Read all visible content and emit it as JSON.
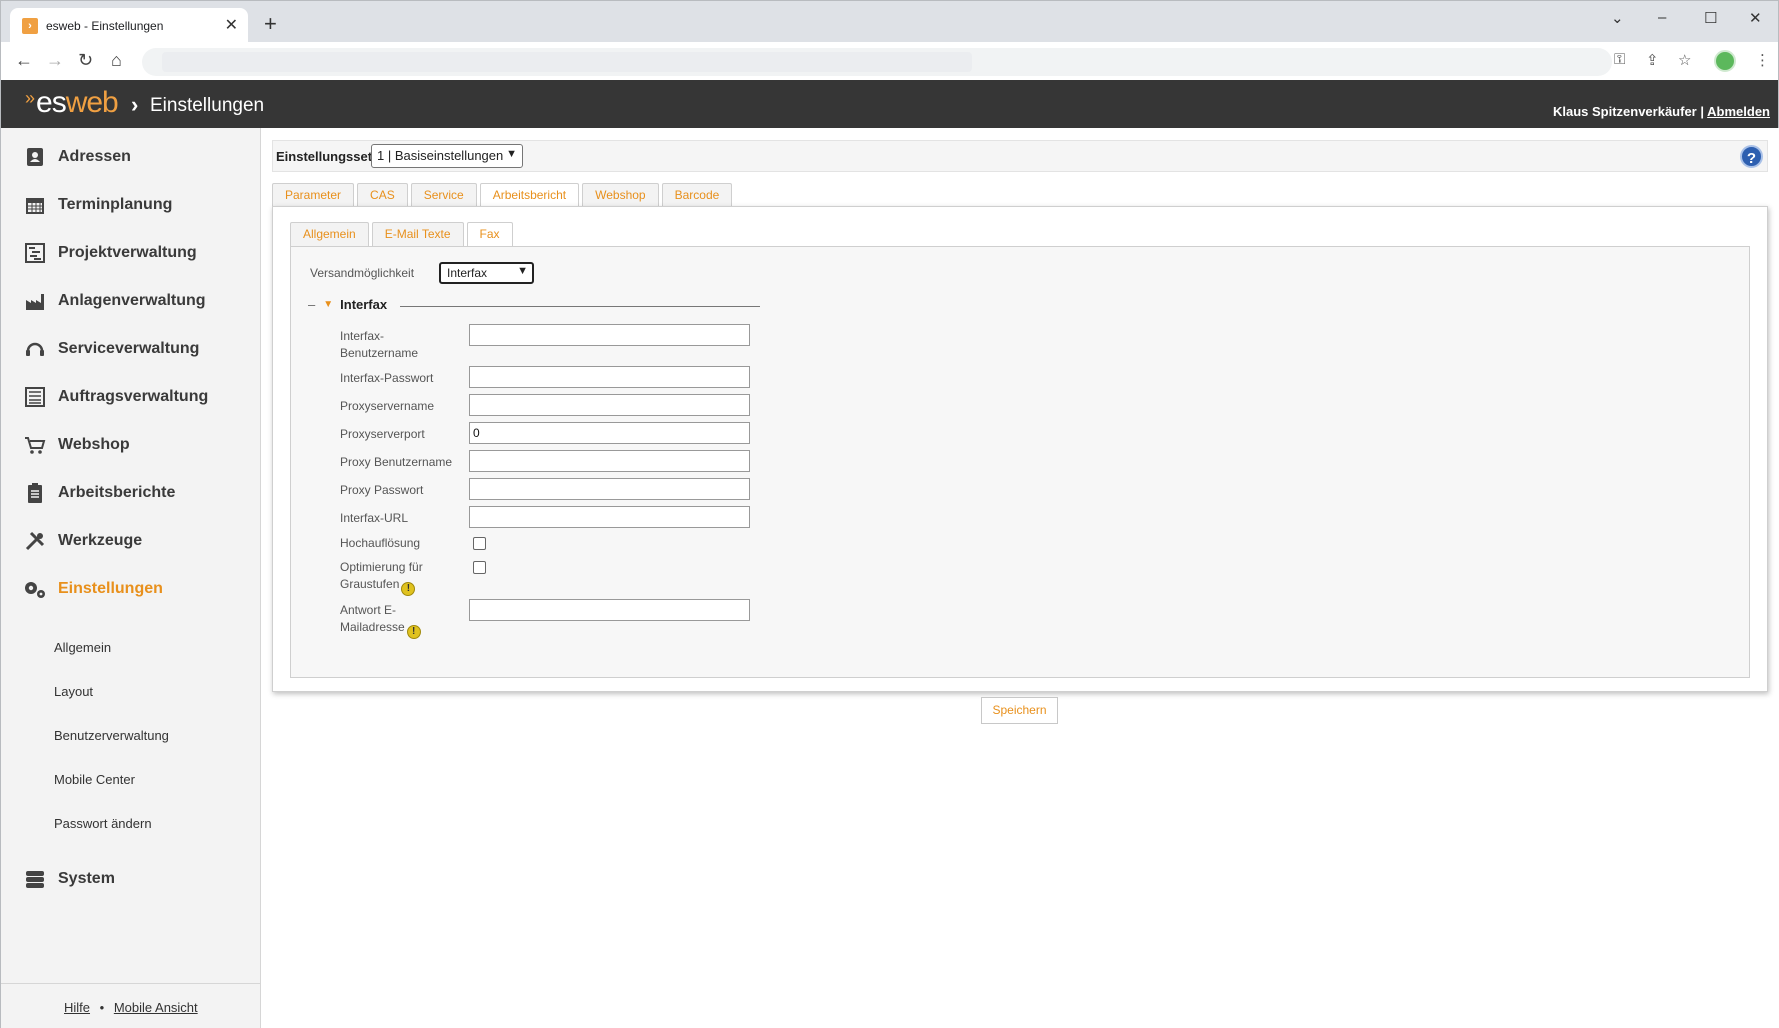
{
  "browser": {
    "tab_title": "esweb - Einstellungen",
    "favicon": "esweb-favicon",
    "new_tab": "+",
    "minimize": "⌄",
    "min": "–",
    "max": "☐",
    "close": "✕"
  },
  "header": {
    "logo_es": "es",
    "logo_web": "web",
    "separator": "›",
    "title": "Einstellungen",
    "user": "Klaus Spitzenverkäufer",
    "divider": "|",
    "logout": "Abmelden"
  },
  "sidebar": {
    "items": [
      {
        "label": "Adressen",
        "icon": "address-book-icon"
      },
      {
        "label": "Terminplanung",
        "icon": "calendar-icon"
      },
      {
        "label": "Projektverwaltung",
        "icon": "gantt-icon"
      },
      {
        "label": "Anlagenverwaltung",
        "icon": "factory-icon"
      },
      {
        "label": "Serviceverwaltung",
        "icon": "headset-icon"
      },
      {
        "label": "Auftragsverwaltung",
        "icon": "list-icon"
      },
      {
        "label": "Webshop",
        "icon": "cart-icon"
      },
      {
        "label": "Arbeitsberichte",
        "icon": "clipboard-icon"
      },
      {
        "label": "Werkzeuge",
        "icon": "tools-icon"
      },
      {
        "label": "Einstellungen",
        "icon": "gears-icon"
      },
      {
        "label": "System",
        "icon": "server-icon"
      }
    ],
    "subitems": [
      "Allgemein",
      "Layout",
      "Benutzerverwaltung",
      "Mobile Center",
      "Passwort ändern"
    ],
    "footer_help": "Hilfe",
    "footer_dot": "•",
    "footer_mobile": "Mobile Ansicht"
  },
  "settingset": {
    "label": "Einstellungsset",
    "value": "1 | Basiseinstellungen",
    "help": "?"
  },
  "tabs": [
    "Parameter",
    "CAS",
    "Service",
    "Arbeitsbericht",
    "Webshop",
    "Barcode"
  ],
  "active_tab": "Arbeitsbericht",
  "subtabs": [
    "Allgemein",
    "E-Mail Texte",
    "Fax"
  ],
  "active_subtab": "Fax",
  "form": {
    "versand_label": "Versandmöglichkeit",
    "versand_value": "Interfax",
    "fieldset_title": "Interfax",
    "fields": {
      "username_label_1": "Interfax-",
      "username_label_2": "Benutzername",
      "username_value": "",
      "password_label": "Interfax-Passwort",
      "password_value": "",
      "proxyname_label": "Proxyservername",
      "proxyname_value": "",
      "proxyport_label": "Proxyserverport",
      "proxyport_value": "0",
      "proxyuser_label": "Proxy Benutzername",
      "proxyuser_value": "",
      "proxypass_label": "Proxy Passwort",
      "proxypass_value": "",
      "url_label": "Interfax-URL",
      "url_value": "",
      "hires_label": "Hochauflösung",
      "gray_label_1": "Optimierung für",
      "gray_label_2": "Graustufen",
      "reply_label_1": "Antwort E-",
      "reply_label_2": "Mailadresse",
      "reply_value": ""
    },
    "warn_glyph": "!"
  },
  "save_button": "Speichern",
  "colors": {
    "accent": "#e8901c",
    "header_bg": "#363636"
  }
}
